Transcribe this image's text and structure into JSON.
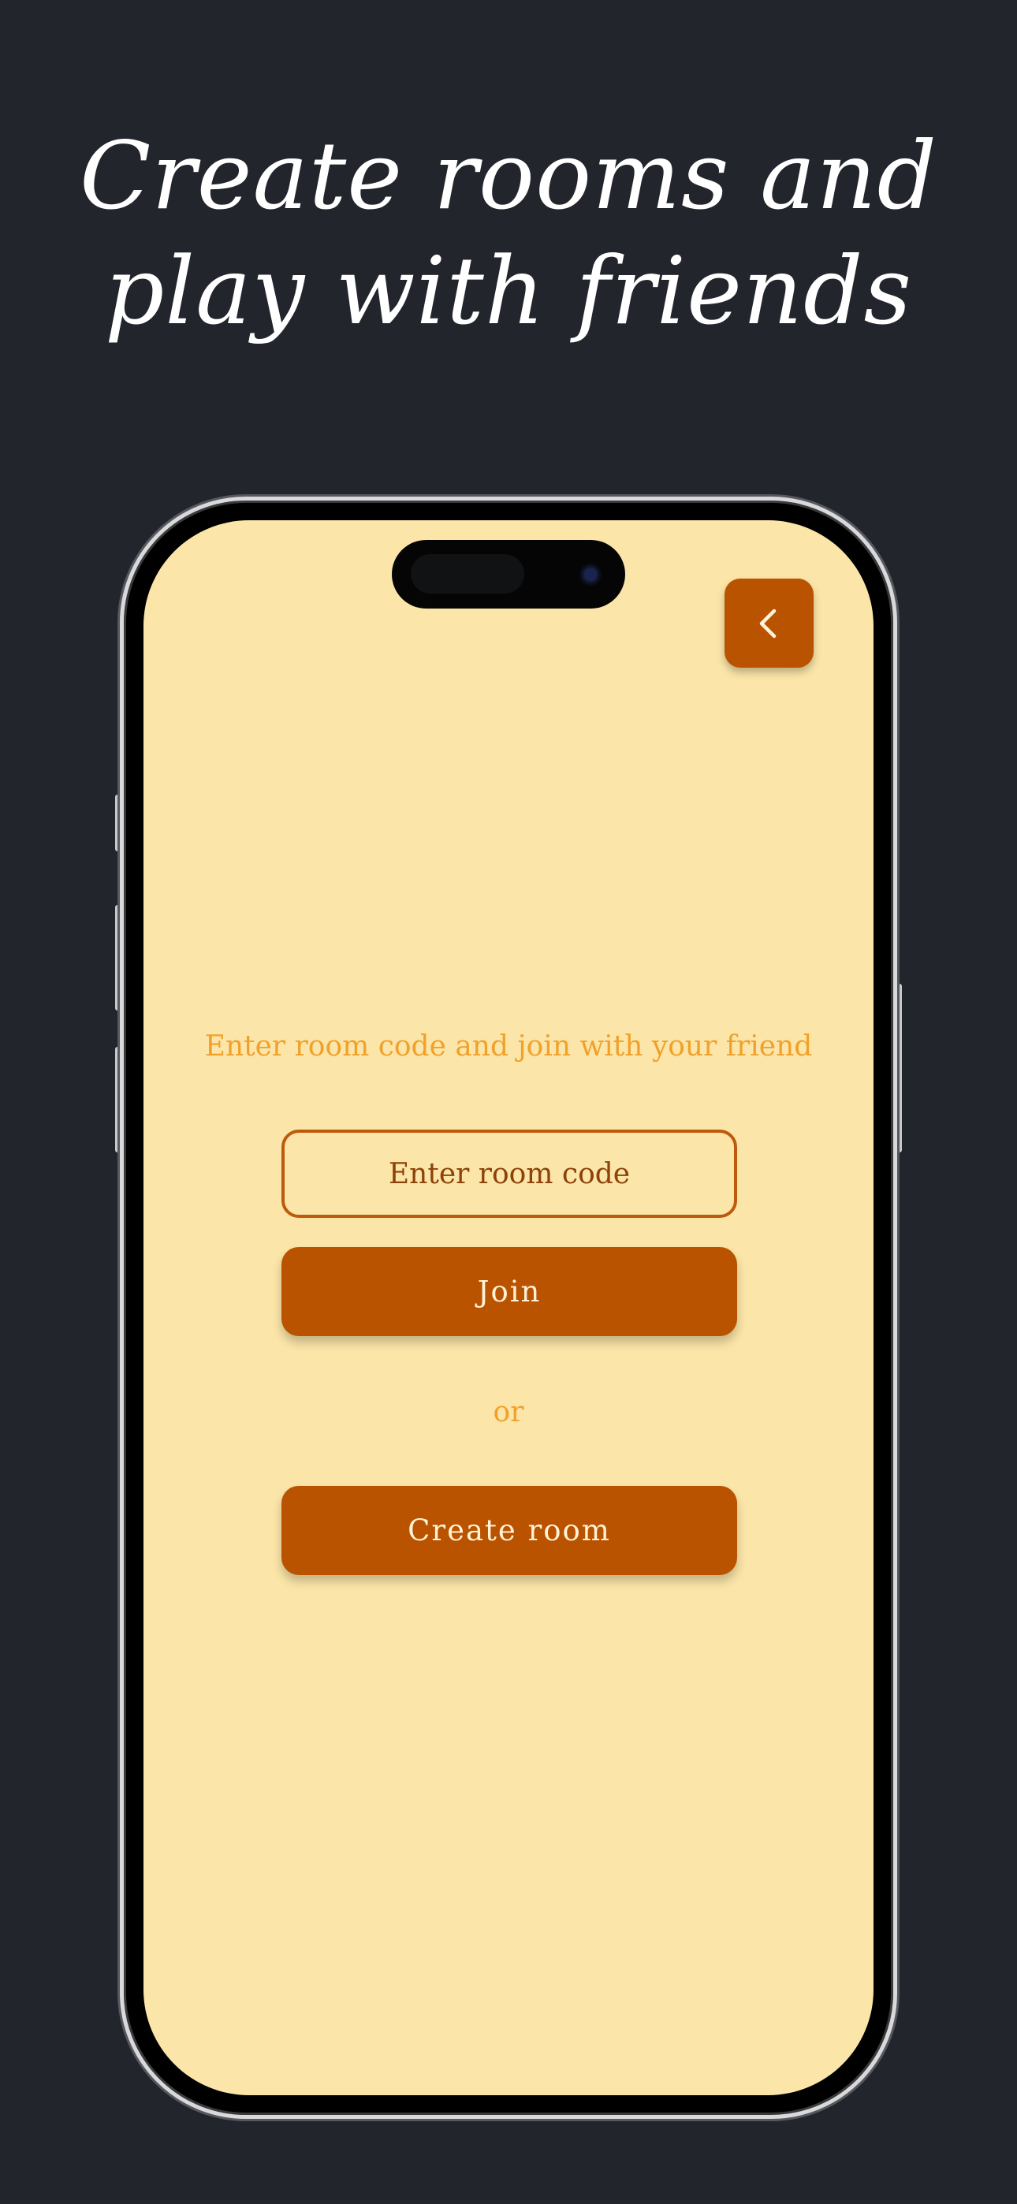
{
  "headline": {
    "line1": "Create rooms and",
    "line2": "play with friends"
  },
  "screen": {
    "back_icon": "chevron-left-icon",
    "prompt": "Enter room code and join with your friend",
    "room_code_placeholder": "Enter room code",
    "room_code_value": "",
    "join_label": "Join",
    "or_label": "or",
    "create_room_label": "Create room"
  },
  "colors": {
    "page_background": "#22252b",
    "screen_background": "#fbe5a8",
    "accent": "#b95300",
    "prompt_text": "#f1a12a",
    "button_text": "#fff2d6"
  }
}
